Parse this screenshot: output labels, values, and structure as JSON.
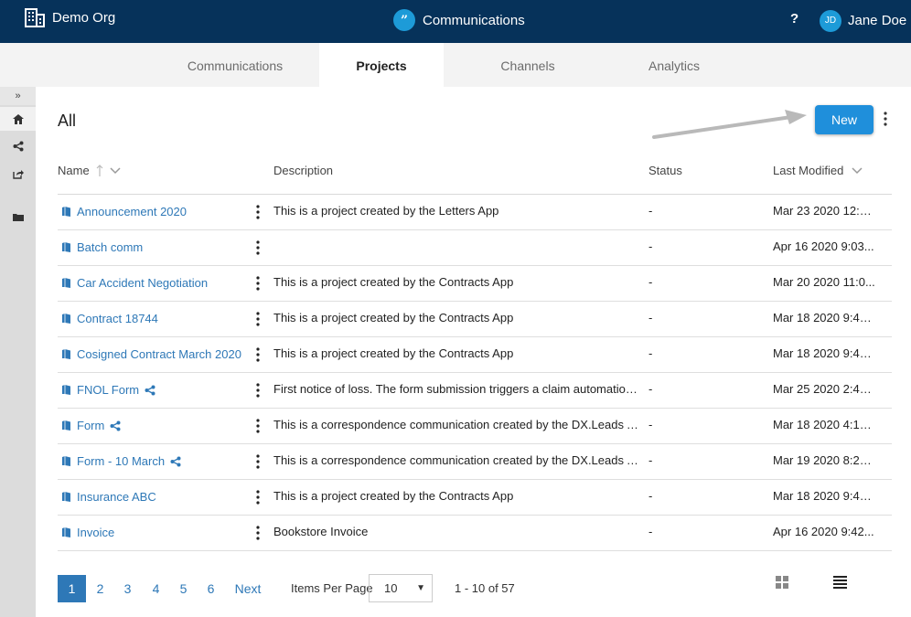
{
  "header": {
    "org_name": "Demo Org",
    "app_badge": "”",
    "app_title": "Communications",
    "help": "?",
    "user_initials": "JD",
    "user_name": "Jane Doe"
  },
  "tabs": [
    {
      "label": "Communications",
      "active": false
    },
    {
      "label": "Projects",
      "active": true
    },
    {
      "label": "Channels",
      "active": false
    },
    {
      "label": "Analytics",
      "active": false
    }
  ],
  "sidebar": {
    "expand_glyph": "»",
    "items": [
      {
        "icon": "home-icon",
        "active": true
      },
      {
        "icon": "share-icon",
        "active": false
      },
      {
        "icon": "export-icon",
        "active": false
      },
      {
        "icon": "folder-icon",
        "active": false
      }
    ]
  },
  "page": {
    "title": "All",
    "new_label": "New"
  },
  "table": {
    "columns": {
      "name": "Name",
      "description": "Description",
      "status": "Status",
      "last_modified": "Last Modified"
    },
    "rows": [
      {
        "name": "Announcement 2020",
        "shared": false,
        "description": "This is a project created by the Letters App",
        "status": "-",
        "modified": "Mar 23 2020 12:5..."
      },
      {
        "name": "Batch comm",
        "shared": false,
        "description": "",
        "status": "-",
        "modified": "Apr 16 2020 9:03..."
      },
      {
        "name": "Car Accident Negotiation",
        "shared": false,
        "description": "This is a project created by the Contracts App",
        "status": "-",
        "modified": "Mar 20 2020 11:0..."
      },
      {
        "name": "Contract 18744",
        "shared": false,
        "description": "This is a project created by the Contracts App",
        "status": "-",
        "modified": "Mar 18 2020 9:44..."
      },
      {
        "name": "Cosigned Contract March 2020",
        "shared": false,
        "description": "This is a project created by the Contracts App",
        "status": "-",
        "modified": "Mar 18 2020 9:44..."
      },
      {
        "name": "FNOL Form",
        "shared": true,
        "description": "First notice of loss. The form submission triggers a claim automation pr...",
        "status": "-",
        "modified": "Mar 25 2020 2:49..."
      },
      {
        "name": "Form",
        "shared": true,
        "description": "This is a correspondence communication created by the DX.Leads App",
        "status": "-",
        "modified": "Mar 18 2020 4:14..."
      },
      {
        "name": "Form - 10 March",
        "shared": true,
        "description": "This is a correspondence communication created by the DX.Leads App",
        "status": "-",
        "modified": "Mar 19 2020 8:20..."
      },
      {
        "name": "Insurance ABC",
        "shared": false,
        "description": "This is a project created by the Contracts App",
        "status": "-",
        "modified": "Mar 18 2020 9:42..."
      },
      {
        "name": "Invoice",
        "shared": false,
        "description": "Bookstore Invoice",
        "status": "-",
        "modified": "Apr 16 2020 9:42..."
      }
    ]
  },
  "pagination": {
    "pages": [
      "1",
      "2",
      "3",
      "4",
      "5",
      "6"
    ],
    "current": "1",
    "next_label": "Next",
    "items_per_page_label": "Items Per Page",
    "items_per_page_value": "10",
    "range_text": "1 - 10 of 57"
  },
  "colors": {
    "header_bg": "#06325a",
    "accent": "#1f8fdb",
    "link": "#2e78b7"
  }
}
